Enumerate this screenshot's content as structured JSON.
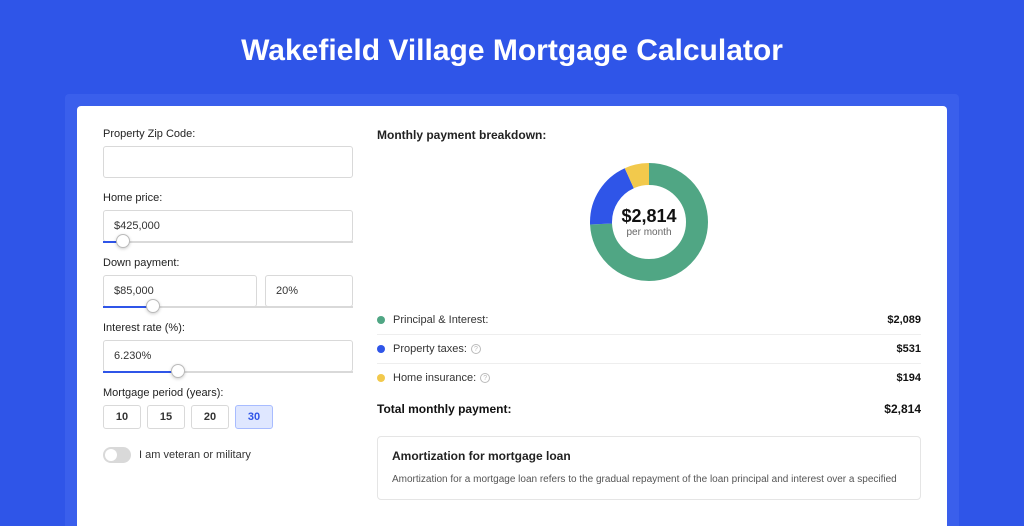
{
  "page_title": "Wakefield Village Mortgage Calculator",
  "form": {
    "zip": {
      "label": "Property Zip Code:",
      "value": ""
    },
    "home_price": {
      "label": "Home price:",
      "value": "$425,000",
      "slider_pct": 8
    },
    "down_payment": {
      "label": "Down payment:",
      "amount": "$85,000",
      "percent": "20%",
      "slider_pct": 20
    },
    "interest_rate": {
      "label": "Interest rate (%):",
      "value": "6.230%",
      "slider_pct": 30
    },
    "period": {
      "label": "Mortgage period (years):",
      "options": [
        "10",
        "15",
        "20",
        "30"
      ],
      "active": "30"
    },
    "veteran": {
      "label": "I am veteran or military",
      "on": false
    }
  },
  "breakdown": {
    "title": "Monthly payment breakdown:",
    "center_amount": "$2,814",
    "center_sub": "per month",
    "items": [
      {
        "label": "Principal & Interest:",
        "value": "$2,089",
        "color": "#50a684",
        "info": false,
        "pct": 74.2
      },
      {
        "label": "Property taxes:",
        "value": "$531",
        "color": "#2f55e8",
        "info": true,
        "pct": 18.9
      },
      {
        "label": "Home insurance:",
        "value": "$194",
        "color": "#f2c94c",
        "info": true,
        "pct": 6.9
      }
    ],
    "total_label": "Total monthly payment:",
    "total_value": "$2,814"
  },
  "amortization": {
    "title": "Amortization for mortgage loan",
    "text": "Amortization for a mortgage loan refers to the gradual repayment of the loan principal and interest over a specified"
  },
  "chart_data": {
    "type": "pie",
    "title": "Monthly payment breakdown",
    "series": [
      {
        "name": "Principal & Interest",
        "value": 2089,
        "color": "#50a684"
      },
      {
        "name": "Property taxes",
        "value": 531,
        "color": "#2f55e8"
      },
      {
        "name": "Home insurance",
        "value": 194,
        "color": "#f2c94c"
      }
    ],
    "total": 2814,
    "unit": "USD per month"
  }
}
